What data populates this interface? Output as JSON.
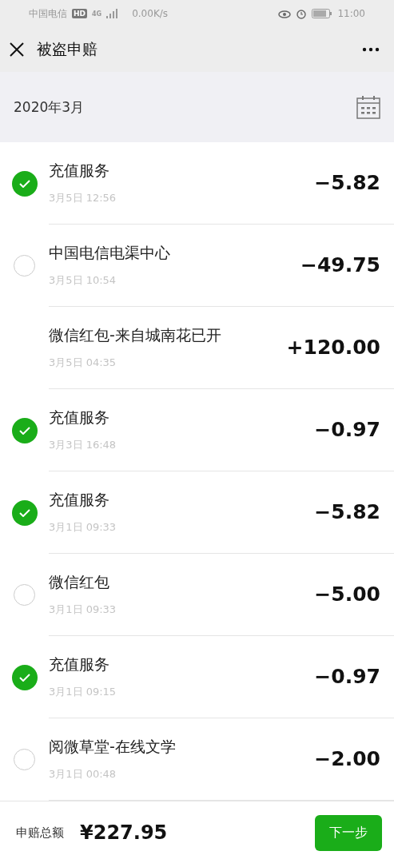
{
  "status_bar": {
    "carrier": "中国电信",
    "hd": "HD",
    "network": "4G",
    "speed": "0.00K/s",
    "time": "11:00"
  },
  "nav": {
    "title": "被盗申赔"
  },
  "month": {
    "label": "2020年3月"
  },
  "transactions": [
    {
      "kind": "selectable",
      "selected": true,
      "title": "充值服务",
      "time": "3月5日 12:56",
      "amount": "−5.82"
    },
    {
      "kind": "selectable",
      "selected": false,
      "title": "中国电信电渠中心",
      "time": "3月5日 10:54",
      "amount": "−49.75"
    },
    {
      "kind": "plain",
      "title": "微信红包-来自城南花已开",
      "time": "3月5日 04:35",
      "amount": "+120.00"
    },
    {
      "kind": "selectable",
      "selected": true,
      "title": "充值服务",
      "time": "3月3日 16:48",
      "amount": "−0.97"
    },
    {
      "kind": "selectable",
      "selected": true,
      "title": "充值服务",
      "time": "3月1日 09:33",
      "amount": "−5.82"
    },
    {
      "kind": "selectable",
      "selected": false,
      "title": "微信红包",
      "time": "3月1日 09:33",
      "amount": "−5.00"
    },
    {
      "kind": "selectable",
      "selected": true,
      "title": "充值服务",
      "time": "3月1日 09:15",
      "amount": "−0.97"
    },
    {
      "kind": "selectable",
      "selected": false,
      "title": "阅微草堂-在线文学",
      "time": "3月1日 00:48",
      "amount": "−2.00"
    }
  ],
  "footer": {
    "total_label": "申赔总额",
    "total": "¥227.95",
    "button": "下一步"
  }
}
